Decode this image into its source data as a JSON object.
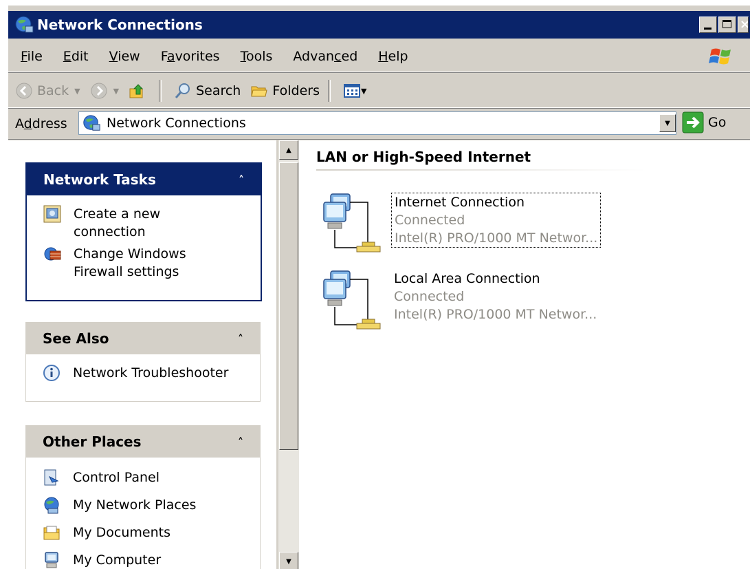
{
  "window": {
    "title": "Network Connections"
  },
  "menu": {
    "items": [
      {
        "label": "File",
        "u": "F",
        "rest": "ile"
      },
      {
        "label": "Edit",
        "u": "E",
        "rest": "dit"
      },
      {
        "label": "View",
        "u": "V",
        "rest": "iew"
      },
      {
        "label": "Favorites",
        "pre": "F",
        "u": "a",
        "rest": "vorites"
      },
      {
        "label": "Tools",
        "u": "T",
        "rest": "ools"
      },
      {
        "label": "Advanced",
        "pre": "Advan",
        "u": "c",
        "rest": "ed"
      },
      {
        "label": "Help",
        "u": "H",
        "rest": "elp"
      }
    ]
  },
  "toolbar": {
    "back_label": "Back",
    "search_label": "Search",
    "folders_label": "Folders"
  },
  "address": {
    "label_pre": "A",
    "label_u": "d",
    "label_rest": "dress",
    "value": "Network Connections",
    "go_label": "Go"
  },
  "panels": {
    "network_tasks": {
      "title": "Network Tasks",
      "items": [
        {
          "line1": "Create a new",
          "line2": "connection",
          "icon": "new-connection-icon"
        },
        {
          "line1": "Change Windows",
          "line2": "Firewall settings",
          "icon": "firewall-icon"
        }
      ]
    },
    "see_also": {
      "title": "See Also",
      "items": [
        {
          "label": "Network Troubleshooter",
          "icon": "info-icon"
        }
      ]
    },
    "other_places": {
      "title": "Other Places",
      "items": [
        {
          "label": "Control Panel",
          "icon": "control-panel-icon"
        },
        {
          "label": "My Network Places",
          "icon": "network-places-icon"
        },
        {
          "label": "My Documents",
          "icon": "documents-folder-icon"
        },
        {
          "label": "My Computer",
          "icon": "computer-icon"
        }
      ]
    }
  },
  "content": {
    "group_title": "LAN or High-Speed Internet",
    "connections": [
      {
        "name": "Internet Connection",
        "status": "Connected",
        "device": "Intel(R) PRO/1000 MT Networ...",
        "selected": true
      },
      {
        "name": "Local Area Connection",
        "status": "Connected",
        "device": "Intel(R) PRO/1000 MT Networ...",
        "selected": false
      }
    ]
  },
  "colors": {
    "titlebar": "#0a246a",
    "chrome": "#d4d0c8",
    "disabled_text": "#8e8c86"
  }
}
